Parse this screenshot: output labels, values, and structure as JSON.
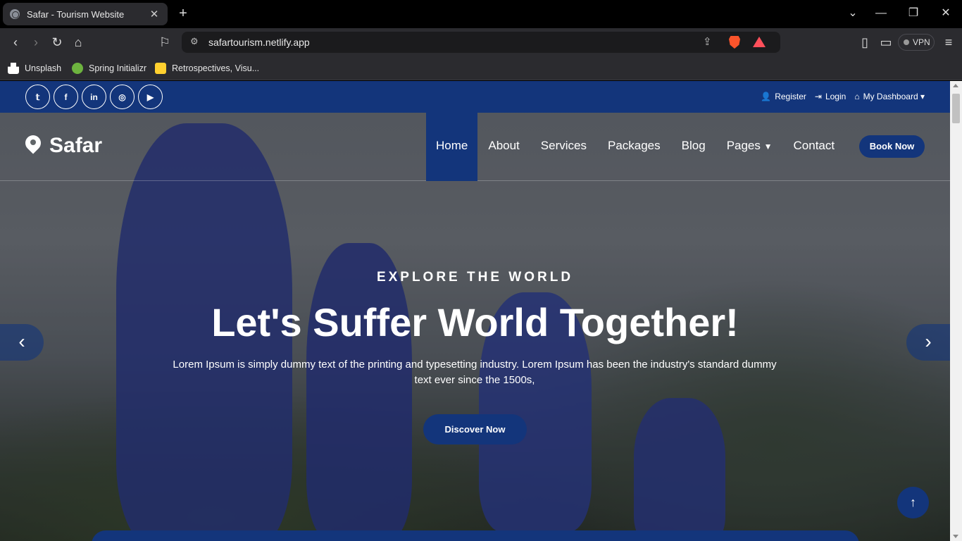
{
  "browser": {
    "tab_title": "Safar - Tourism Website",
    "url": "safartourism.netlify.app",
    "vpn_label": "VPN",
    "bookmarks": [
      {
        "label": "Unsplash",
        "icon": "unsplash-icon"
      },
      {
        "label": "Spring Initializr",
        "icon": "spring-icon"
      },
      {
        "label": "Retrospectives, Visu...",
        "icon": "miro-icon"
      }
    ]
  },
  "topbar": {
    "social": [
      "twitter-icon",
      "facebook-icon",
      "linkedin-icon",
      "instagram-icon",
      "youtube-icon"
    ],
    "social_glyphs": [
      "𝕥",
      "f",
      "in",
      "◎",
      "▶"
    ],
    "register": "Register",
    "login": "Login",
    "dashboard": "My Dashboard"
  },
  "navbar": {
    "logo": "Safar",
    "menu": [
      "Home",
      "About",
      "Services",
      "Packages",
      "Blog",
      "Pages",
      "Contact"
    ],
    "book_now": "Book Now"
  },
  "hero": {
    "eyebrow": "EXPLORE THE WORLD",
    "headline": "Let's Suffer World Together!",
    "description": "Lorem Ipsum is simply dummy text of the printing and typesetting industry. Lorem Ipsum has been the industry's standard dummy text ever since the 1500s,",
    "cta": "Discover Now"
  },
  "colors": {
    "brand": "#13357b"
  }
}
